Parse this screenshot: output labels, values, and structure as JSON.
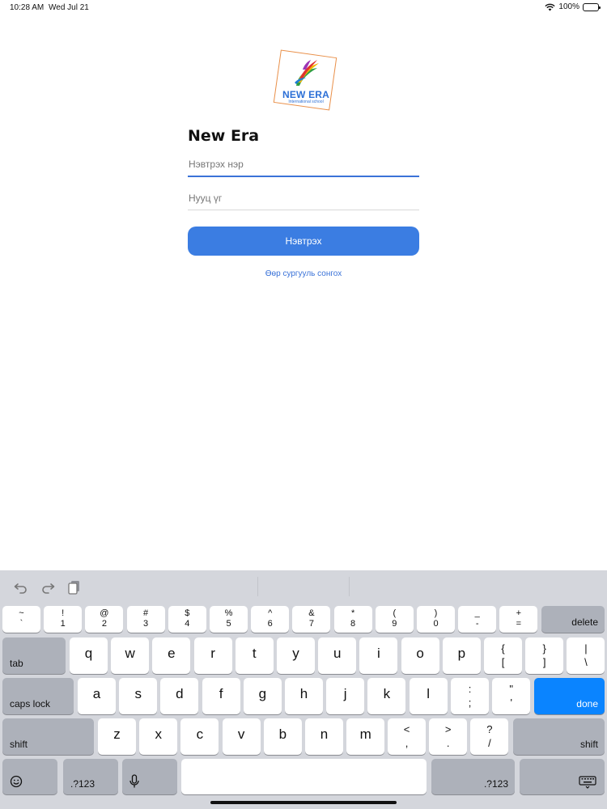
{
  "status_bar": {
    "time": "10:28 AM",
    "date": "Wed Jul 21",
    "battery": "100%",
    "wifi_icon": "wifi-icon",
    "battery_icon": "battery-icon"
  },
  "logo": {
    "text": "NEW ERA",
    "subtext": "International school"
  },
  "form": {
    "title": "New Era",
    "username_placeholder": "Нэвтрэх нэр",
    "username_value": "",
    "password_placeholder": "Нууц үг",
    "password_value": "",
    "login_label": "Нэвтрэх",
    "other_school_label": "Өөр сургууль сонгох"
  },
  "colors": {
    "accent": "#3b7de2",
    "keyboard_done": "#0a84ff",
    "keyboard_bg": "#d4d6dc"
  },
  "keyboard": {
    "toolbar": [
      "undo-icon",
      "redo-icon",
      "paste-icon"
    ],
    "row_numbers": [
      {
        "top": "~",
        "bottom": "`"
      },
      {
        "top": "!",
        "bottom": "1"
      },
      {
        "top": "@",
        "bottom": "2"
      },
      {
        "top": "#",
        "bottom": "3"
      },
      {
        "top": "$",
        "bottom": "4"
      },
      {
        "top": "%",
        "bottom": "5"
      },
      {
        "top": "^",
        "bottom": "6"
      },
      {
        "top": "&",
        "bottom": "7"
      },
      {
        "top": "*",
        "bottom": "8"
      },
      {
        "top": "(",
        "bottom": "9"
      },
      {
        "top": ")",
        "bottom": "0"
      },
      {
        "top": "_",
        "bottom": "-"
      },
      {
        "top": "+",
        "bottom": "="
      }
    ],
    "delete_label": "delete",
    "tab_label": "tab",
    "row_q": [
      "q",
      "w",
      "e",
      "r",
      "t",
      "y",
      "u",
      "i",
      "o",
      "p"
    ],
    "row_q_symbols": [
      {
        "top": "{",
        "bottom": "["
      },
      {
        "top": "}",
        "bottom": "]"
      },
      {
        "top": "|",
        "bottom": "\\"
      }
    ],
    "caps_label": "caps lock",
    "row_a": [
      "a",
      "s",
      "d",
      "f",
      "g",
      "h",
      "j",
      "k",
      "l"
    ],
    "row_a_symbols": [
      {
        "top": ":",
        "bottom": ";"
      },
      {
        "top": "\"",
        "bottom": "'"
      }
    ],
    "done_label": "done",
    "shift_label": "shift",
    "row_z": [
      "z",
      "x",
      "c",
      "v",
      "b",
      "n",
      "m"
    ],
    "row_z_symbols": [
      {
        "top": "<",
        "bottom": ","
      },
      {
        "top": ">",
        "bottom": "."
      },
      {
        "top": "?",
        "bottom": "/"
      }
    ],
    "numbers_label": ".?123"
  }
}
